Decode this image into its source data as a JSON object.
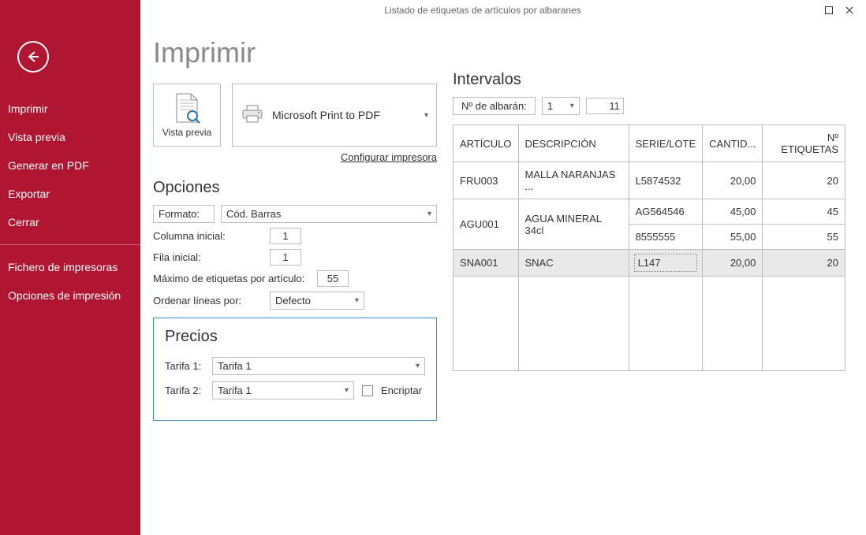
{
  "window_title": "Listado de etiquetas de artículos por albaranes",
  "sidebar": [
    {
      "label": "Imprimir"
    },
    {
      "label": "Vista previa"
    },
    {
      "label": "Generar en PDF"
    },
    {
      "label": "Exportar"
    },
    {
      "label": "Cerrar"
    }
  ],
  "sidebar2": [
    {
      "label": "Fichero de impresoras"
    },
    {
      "label": "Opciones de impresión"
    }
  ],
  "page_title": "Imprimir",
  "preview_label": "Vista previa",
  "printer_name": "Microsoft Print to PDF",
  "config_link": "Configurar impresora",
  "opciones": {
    "title": "Opciones",
    "formato_label": "Formato:",
    "formato_value": "Cód. Barras",
    "col_label": "Columna inicial:",
    "col_value": "1",
    "fila_label": "Fila inicial:",
    "fila_value": "1",
    "max_label": "Máximo de etiquetas por artículo:",
    "max_value": "55",
    "orden_label": "Ordenar líneas por:",
    "orden_value": "Defecto"
  },
  "precios": {
    "title": "Precios",
    "t1_label": "Tarifa 1:",
    "t1_value": "Tarifa 1",
    "t2_label": "Tarifa 2:",
    "t2_value": "Tarifa 1",
    "encriptar": "Encriptar"
  },
  "intervalos": {
    "title": "Intervalos",
    "nalbaran": "Nº de albarán:",
    "from": "1",
    "to": "11",
    "headers": [
      "ARTÍCULO",
      "DESCRIPCIÓN",
      "SERIE/LOTE",
      "CANTID...",
      "Nº ETIQUETAS"
    ],
    "rows": [
      {
        "art": "FRU003",
        "desc": "MALLA NARANJAS ...",
        "lots": [
          {
            "serie": "L5874532",
            "cant": "20,00",
            "net": "20"
          }
        ]
      },
      {
        "art": "AGU001",
        "desc": "AGUA MINERAL 34cl",
        "lots": [
          {
            "serie": "AG564546",
            "cant": "45,00",
            "net": "45"
          },
          {
            "serie": "8555555",
            "cant": "55,00",
            "net": "55"
          }
        ]
      },
      {
        "art": "SNA001",
        "desc": "SNAC",
        "lots": [
          {
            "serie": "L147",
            "cant": "20,00",
            "net": "20"
          }
        ],
        "selected": true
      }
    ]
  }
}
